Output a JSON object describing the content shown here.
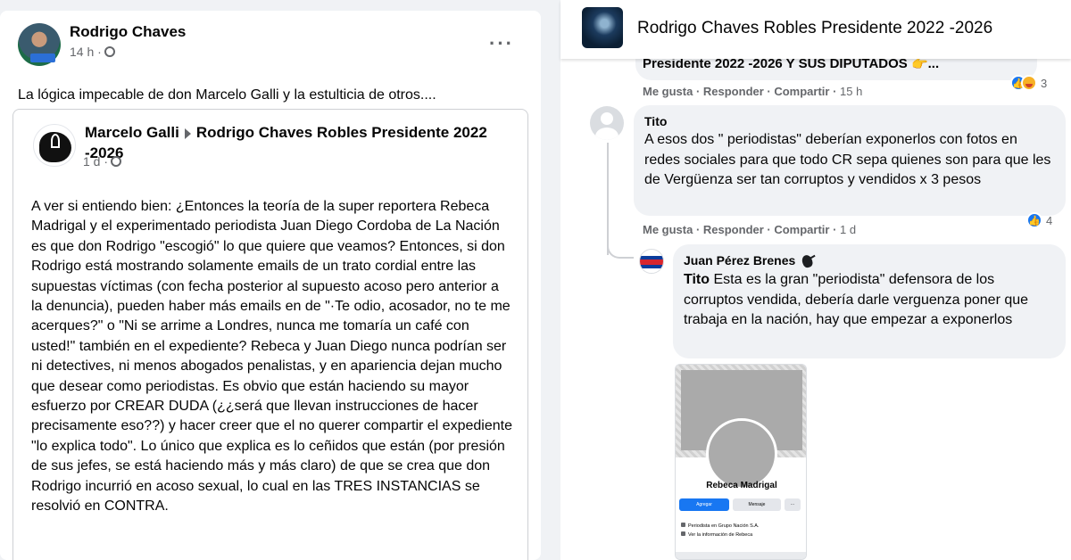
{
  "post": {
    "author": "Rodrigo Chaves",
    "time": "14 h ·",
    "text": "La lógica impecable de don Marcelo Galli y la estulticia de otros....",
    "shared": {
      "author": "Marcelo Galli",
      "group": "Rodrigo Chaves Robles Presidente 2022 -2026",
      "time": "1 d ·",
      "body": "A ver si entiendo bien: ¿Entonces la teoría de la super reportera Rebeca Madrigal y el experimentado periodista Juan Diego Cordoba de La Nación es que don Rodrigo \"escogió\" lo que quiere que veamos? Entonces, si don Rodrigo está mostrando solamente emails de un trato cordial entre las supuestas víctimas (con fecha posterior al supuesto acoso pero anterior a la denuncia), pueden haber más emails en de \"·Te odio, acosador, no te me acerques?\" o \"Ni se arrime a Londres, nunca me tomaría un café con usted!\" también en el expediente? Rebeca y Juan Diego nunca podrían ser ni detectives, ni menos abogados penalistas, y en apariencia dejan mucho que desear como periodistas. Es obvio que están haciendo su mayor esfuerzo por CREAR DUDA (¿¿será que llevan instrucciones de hacer precisamente eso??) y hacer creer que el no querer compartir el expediente \"lo explica todo\". Lo único que explica es lo ceñidos que están (por presión de sus jefes, se está haciendo más y más claro) de que se crea que don Rodrigo incurrió en acoso sexual, lo cual en las TRES INSTANCIAS  se resolvió en CONTRA."
    }
  },
  "group_header": {
    "name": "Rodrigo Chaves Robles Presidente 2022 -2026"
  },
  "comments": {
    "cut_comment": {
      "text": "Presidente 2022 -2026 Y SUS DIPUTADOS 👉...",
      "actions": "Me gusta · Responder · Compartir ·",
      "time": "15 h",
      "reactions": "3"
    },
    "tito": {
      "name": "Tito",
      "text": "A esos dos \" periodistas\" deberían exponerlos con fotos en redes sociales para que todo CR sepa quienes son para que les de Vergüenza ser tan corruptos y vendidos x 3 pesos",
      "actions": "Me gusta · Responder · Compartir ·",
      "time": "1 d",
      "reactions": "4"
    },
    "reply": {
      "name": "Juan Pérez Brenes",
      "mention": "Tito",
      "text": " Esta es la gran \"periodista\" defensora de los corruptos vendida, debería darle verguenza poner que trabaja en la nación, hay que empezar a exponerlos"
    }
  },
  "attachment": {
    "profile_name": "Rebeca Madrigal",
    "add_label": "Agregar",
    "message_label": "Mensaje",
    "more_label": "···",
    "work_line": "Periodista en Grupo Nación S.A.",
    "info_line": "Ver la información de Rebeca"
  }
}
